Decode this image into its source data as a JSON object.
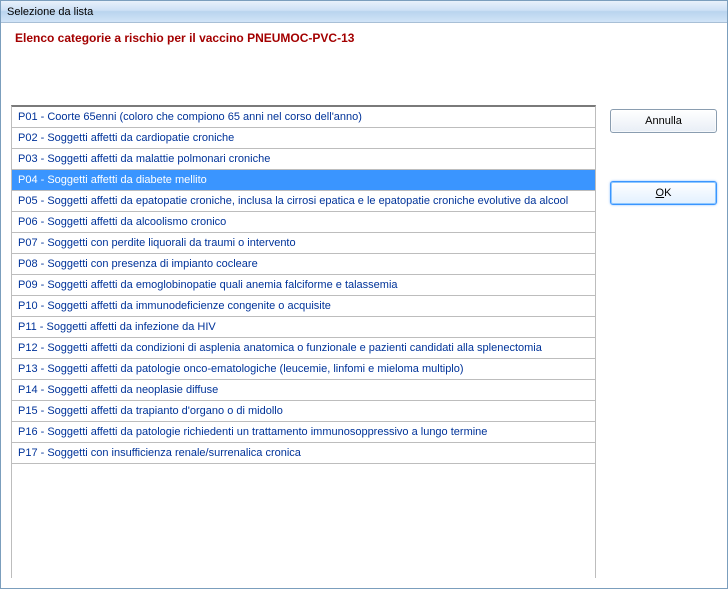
{
  "window": {
    "title": "Selezione da lista"
  },
  "heading": "Elenco categorie a rischio per il vaccino PNEUMOC-PVC-13",
  "list": {
    "selectedIndex": 3,
    "items": [
      "P01 - Coorte 65enni (coloro che compiono 65 anni nel corso dell'anno)",
      "P02 - Soggetti affetti da cardiopatie croniche",
      "P03 - Soggetti affetti da malattie polmonari croniche",
      "P04 - Soggetti affetti da diabete mellito",
      "P05 - Soggetti affetti da epatopatie croniche, inclusa la cirrosi epatica e le epatopatie croniche evolutive da alcool",
      "P06 - Soggetti affetti da alcoolismo cronico",
      "P07 - Soggetti con perdite liquorali da traumi o intervento",
      "P08 - Soggetti con presenza di impianto cocleare",
      "P09 - Soggetti affetti da emoglobinopatie quali anemia falciforme e talassemia",
      "P10 - Soggetti affetti da immunodeficienze congenite o acquisite",
      "P11 - Soggetti affetti da infezione da HIV",
      "P12 - Soggetti affetti da condizioni di asplenia anatomica o funzionale e pazienti candidati alla splenectomia",
      "P13 - Soggetti affetti da patologie onco-ematologiche (leucemie, linfomi e mieloma multiplo)",
      "P14 - Soggetti affetti da neoplasie diffuse",
      "P15 - Soggetti affetti da trapianto d'organo o di midollo",
      "P16 - Soggetti affetti da patologie richiedenti un trattamento immunosoppressivo a lungo termine",
      "P17 - Soggetti con insufficienza renale/surrenalica cronica"
    ]
  },
  "buttons": {
    "cancel": "Annulla",
    "ok_prefix": "O",
    "ok_suffix": "K"
  }
}
